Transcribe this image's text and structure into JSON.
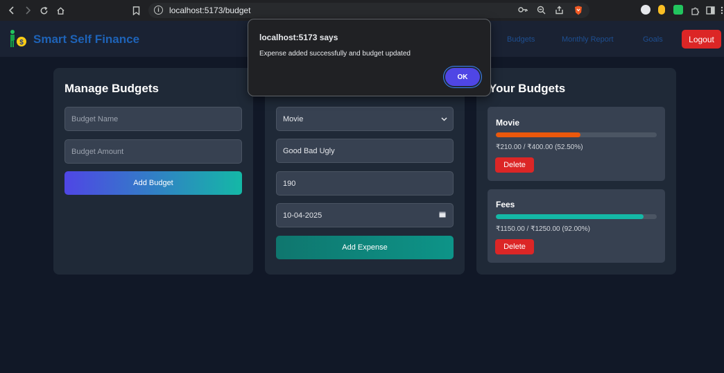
{
  "browser": {
    "url": "localhost:5173/budget"
  },
  "app": {
    "brand": "Smart Self Finance",
    "nav": [
      "Budgets",
      "Monthly Report",
      "Goals"
    ],
    "logout_label": "Logout"
  },
  "manage": {
    "title": "Manage Budgets",
    "name_placeholder": "Budget Name",
    "amount_placeholder": "Budget Amount",
    "add_label": "Add Budget"
  },
  "expense": {
    "category": "Movie",
    "description": "Good Bad Ugly",
    "amount": "190",
    "date": "10-04-2025",
    "add_label": "Add Expense"
  },
  "budgets": {
    "title": "Your Budgets",
    "delete_label": "Delete",
    "items": [
      {
        "name": "Movie",
        "amount_text": "₹210.00 / ₹400.00 (52.50%)",
        "percent": 52.5,
        "color": "#ea580c"
      },
      {
        "name": "Fees",
        "amount_text": "₹1150.00 / ₹1250.00 (92.00%)",
        "percent": 92.0,
        "color": "#14b8a6"
      }
    ]
  },
  "dialog": {
    "title": "localhost:5173 says",
    "message": "Expense added successfully and budget updated",
    "ok_label": "OK"
  },
  "colors": {
    "accent": "#4f46e5",
    "danger": "#dc2626",
    "teal": "#0d9488",
    "brand": "#1e63b8"
  }
}
